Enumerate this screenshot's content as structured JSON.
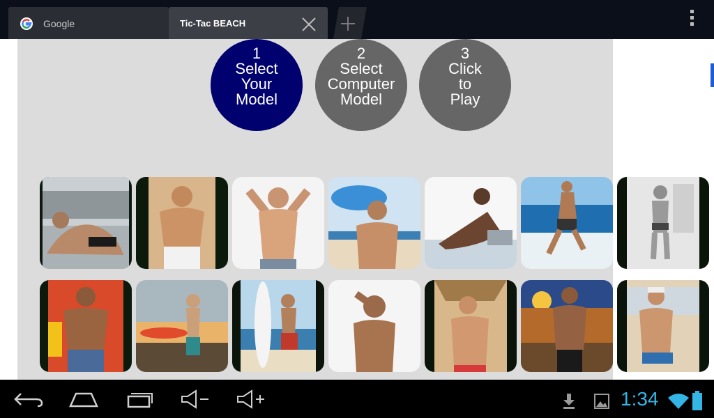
{
  "browser": {
    "tabs": [
      {
        "title": "Google",
        "favicon": "google-g-icon"
      },
      {
        "title": "Tic-Tac BEACH",
        "active": true
      }
    ],
    "new_tab_icon": "plus-icon",
    "menu_icon": "overflow-menu-icon"
  },
  "game": {
    "steps": [
      {
        "number": "1",
        "label": "Select\nYour\nModel",
        "color": "#00006e"
      },
      {
        "number": "2",
        "label": "Select\nComputer\nModel",
        "color": "#666666"
      },
      {
        "number": "3",
        "label": "Click\nto\nPlay",
        "color": "#666666"
      }
    ],
    "models_row1": [
      "model-1-photo",
      "model-2-photo",
      "model-3-photo",
      "model-4-photo",
      "model-5-photo",
      "model-6-photo",
      "model-7-photo"
    ],
    "models_row2": [
      "model-8-photo",
      "model-9-photo",
      "model-10-photo",
      "model-11-photo",
      "model-12-photo",
      "model-13-photo",
      "model-14-photo"
    ]
  },
  "system_bar": {
    "nav_icons": [
      "back-icon",
      "home-icon",
      "recent-apps-icon",
      "volume-down-icon",
      "volume-up-icon"
    ],
    "status_icons": [
      "download-icon",
      "gallery-icon",
      "wifi-icon",
      "battery-icon"
    ],
    "time": "1:34",
    "accent": "#33b5e5"
  }
}
